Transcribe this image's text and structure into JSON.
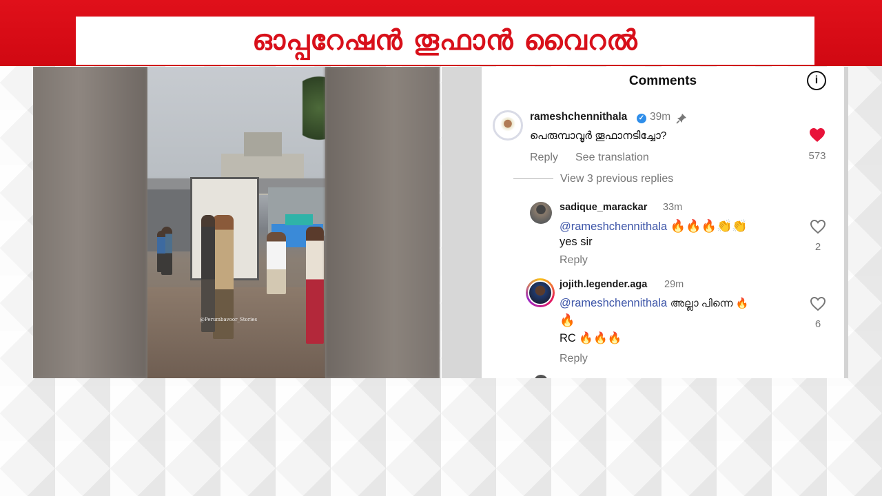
{
  "banner": {
    "headline": "ഓപ്പറേഷൻ തൂഫാൻ വൈറൽ",
    "background_color": "#d8101a"
  },
  "video": {
    "watermark": "@Perumbavoor_Stories"
  },
  "comments": {
    "title": "Comments",
    "info_icon": "info-icon",
    "main": {
      "username": "rameshchennithala",
      "verified_icon": "verified-badge-icon",
      "time": "39m",
      "pin_icon": "pin-icon",
      "text": "പെരുമ്പാവൂർ തൂഫാനടിച്ചോ?",
      "reply": "Reply",
      "see_translation": "See translation",
      "likes": "573",
      "liked": true
    },
    "view_previous": "View 3 previous replies",
    "replies": [
      {
        "username": "sadique_marackar",
        "time": "33m",
        "mention": "@rameshchennithala",
        "text_line1_after": "🔥🔥🔥👏👏",
        "text_line2": "yes sir",
        "reply": "Reply",
        "likes": "2"
      },
      {
        "username": "jojith.legender.aga",
        "time": "29m",
        "mention": "@rameshchennithala",
        "text_line1_after": "അല്ലാ പിന്നെ 🔥",
        "text_line2": "🔥",
        "text_line3": "RC 🔥🔥🔥",
        "reply": "Reply",
        "likes": "6"
      }
    ]
  }
}
